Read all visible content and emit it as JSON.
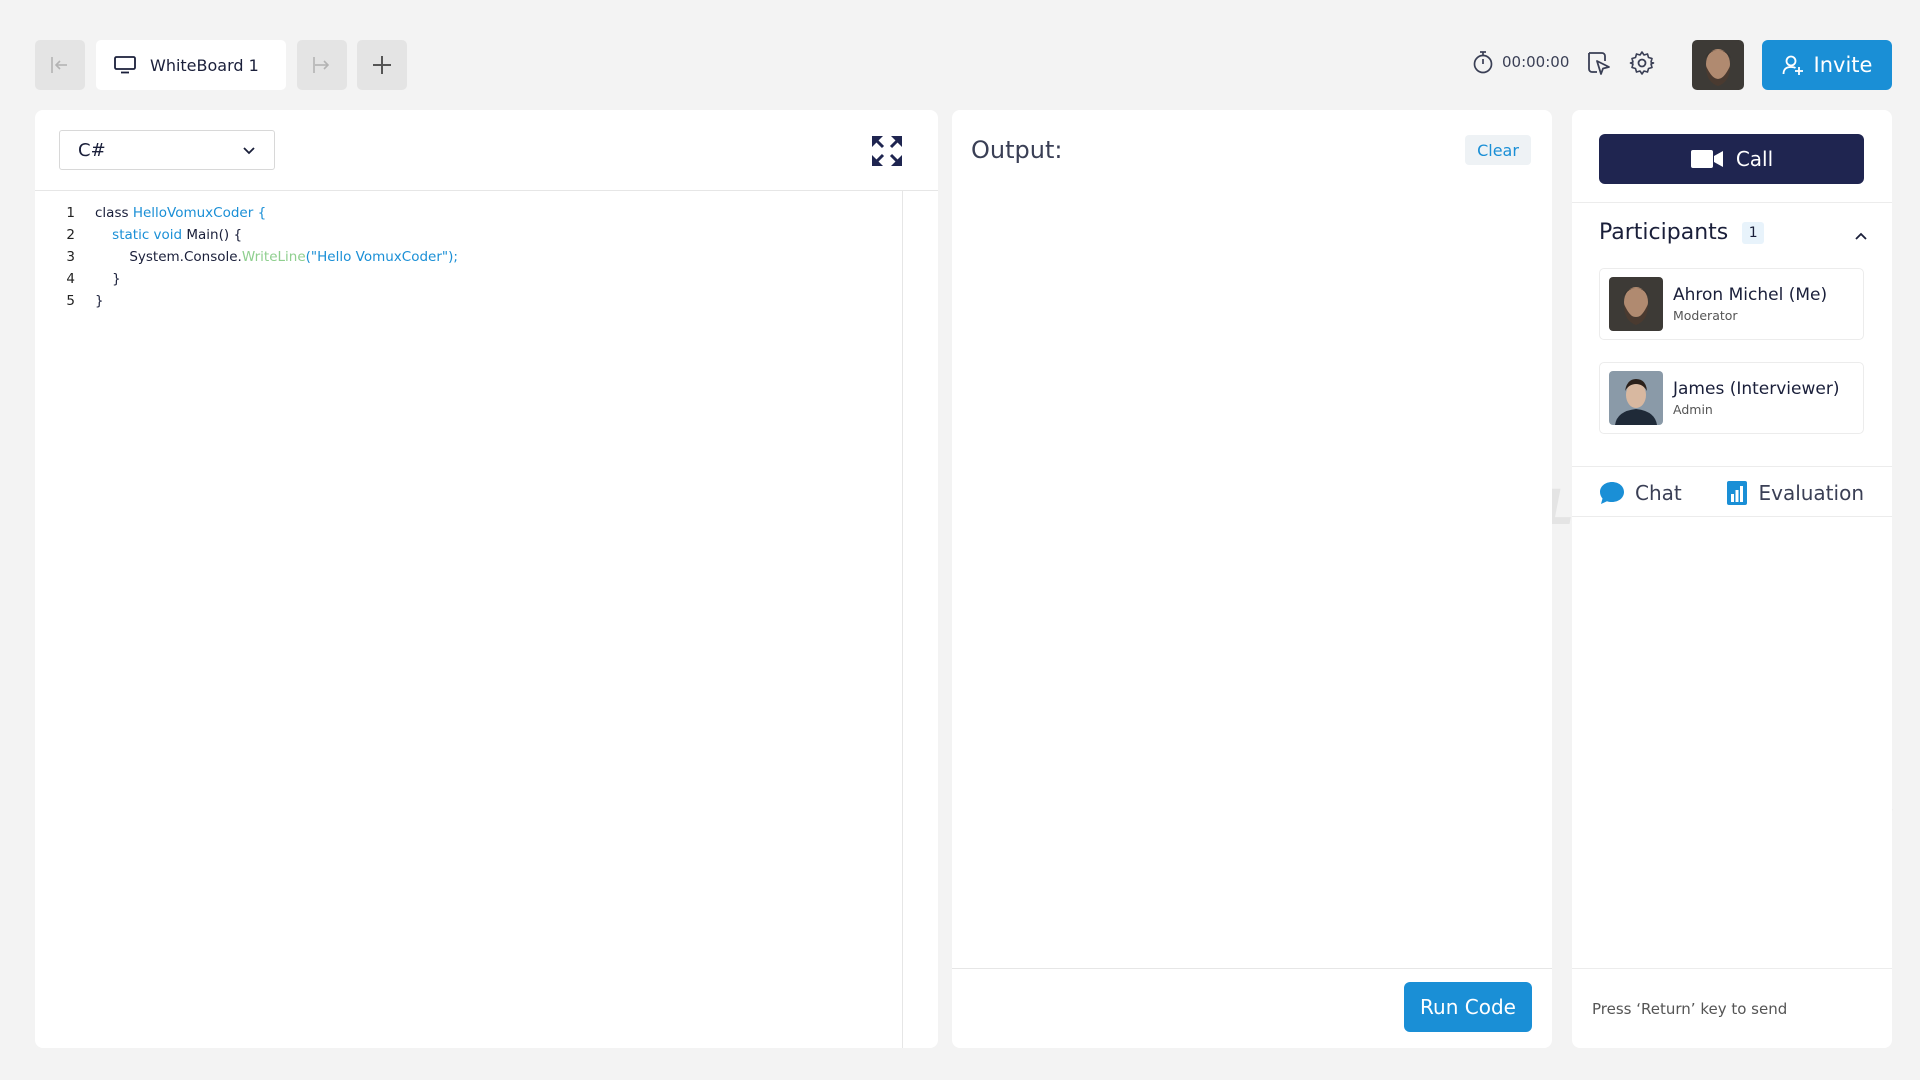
{
  "toolbar": {
    "tab_label": "WhiteBoard 1",
    "timer": "00:00:00",
    "invite_label": "Invite"
  },
  "editor": {
    "language": "C#",
    "lines": [
      {
        "n": "1",
        "code": "class HelloVomuxCoder {"
      },
      {
        "n": "2",
        "code": "    static void Main() {"
      },
      {
        "n": "3",
        "code": "        System.Console.WriteLine(\"Hello VomuxCoder\");"
      },
      {
        "n": "4",
        "code": "    }"
      },
      {
        "n": "5",
        "code": "}"
      }
    ]
  },
  "output": {
    "title": "Output:",
    "clear_label": "Clear",
    "run_label": "Run Code"
  },
  "side": {
    "call_label": "Call",
    "participants_title": "Participants",
    "participants_count": "1",
    "participants": [
      {
        "name": "Ahron Michel (Me)",
        "role": "Moderator"
      },
      {
        "name": "James (Interviewer)",
        "role": "Admin"
      }
    ],
    "tabs": {
      "chat": "Chat",
      "evaluation": "Evaluation"
    },
    "chat_placeholder": "Press ‘Return’ key to send"
  },
  "watermark_text": "SAMPLE",
  "colors": {
    "accent": "#1a8fd6",
    "navy": "#1f2550",
    "background": "#f3f3f3"
  }
}
